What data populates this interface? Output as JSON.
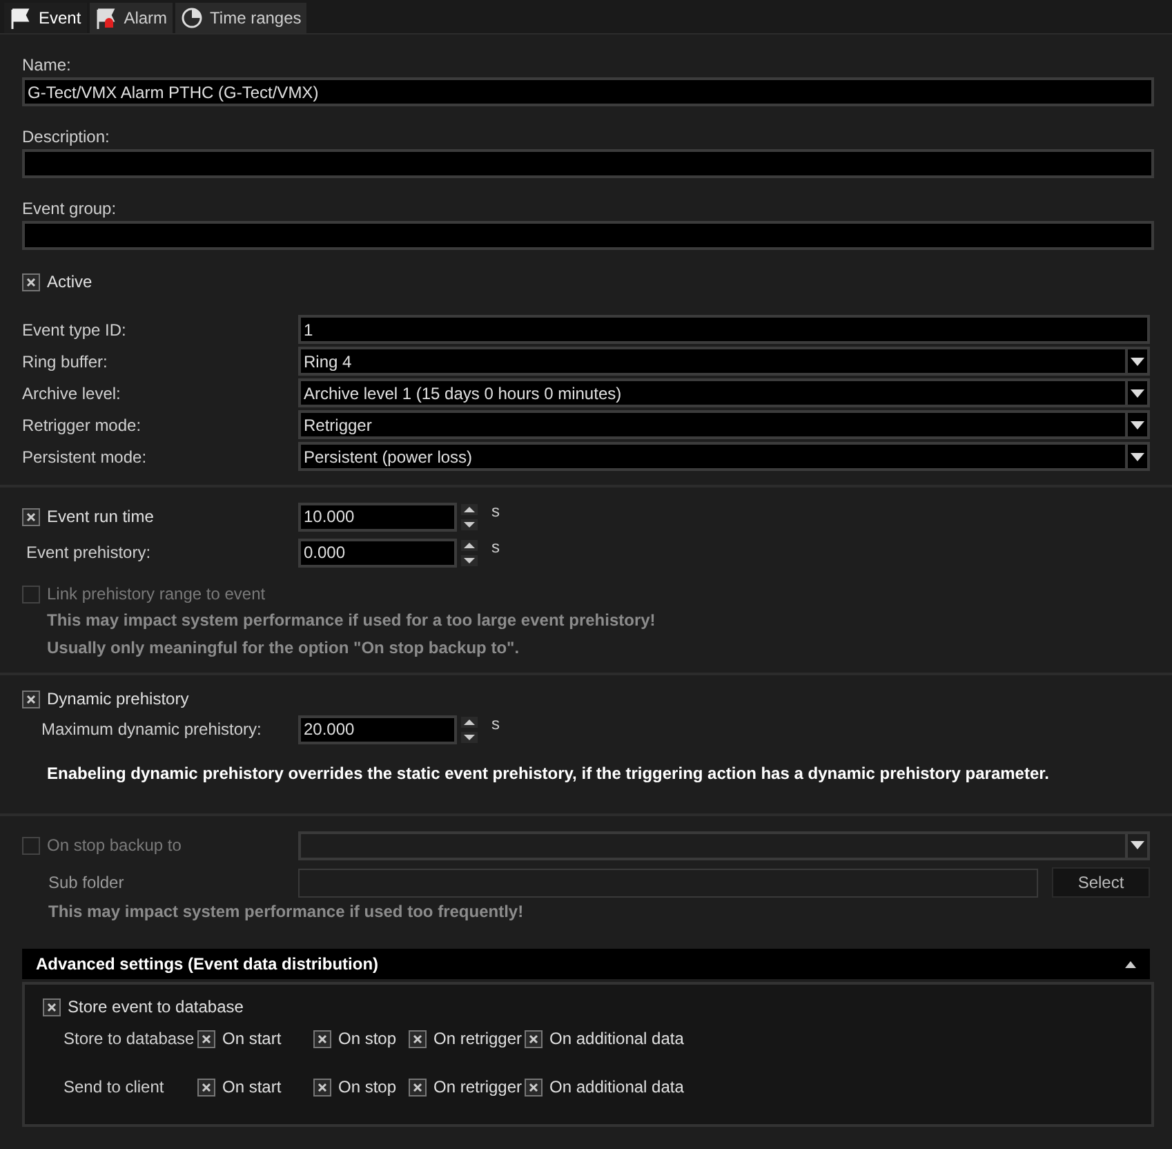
{
  "tabs": [
    {
      "label": "Event",
      "kind": "flag",
      "selected": true
    },
    {
      "label": "Alarm",
      "kind": "alarm",
      "selected": false
    },
    {
      "label": "Time ranges",
      "kind": "clock",
      "selected": false
    }
  ],
  "text_fields": [
    {
      "label": "Name:",
      "value": "G-Tect/VMX Alarm PTHC (G-Tect/VMX)"
    },
    {
      "label": "Description:"
    },
    {
      "label": "Event group:"
    }
  ],
  "active": {
    "label": "Active",
    "checked": true
  },
  "params": [
    {
      "label": "Event type ID:",
      "kind": "input",
      "value": "1"
    },
    {
      "label": "Ring buffer:",
      "kind": "select",
      "value": "Ring 4"
    },
    {
      "label": "Archive level:",
      "kind": "select",
      "value": "Archive level 1 (15 days 0 hours 0 minutes)"
    },
    {
      "label": "Retrigger mode:",
      "kind": "select",
      "value": "Retrigger"
    },
    {
      "label": "Persistent mode:",
      "kind": "select",
      "value": "Persistent (power loss)"
    }
  ],
  "run_time": {
    "label": "Event run time",
    "checked": true,
    "value": "10.000",
    "unit": "s"
  },
  "prehistory": {
    "label": "Event prehistory:",
    "value": "0.000",
    "unit": "s"
  },
  "link_prehistory": {
    "label": "Link prehistory range to event",
    "checked": false,
    "disabled": true
  },
  "link_notes": [
    "This may impact system performance if used for a too large event prehistory!",
    "Usually only meaningful for the option \"On stop backup to\"."
  ],
  "dynamic_prehistory": {
    "label": "Dynamic prehistory",
    "checked": true
  },
  "max_dynamic": {
    "label": "Maximum dynamic prehistory:",
    "value": "20.000",
    "unit": "s"
  },
  "dynamic_note": "Enabeling dynamic prehistory overrides the static event prehistory, if the triggering action has a dynamic prehistory parameter.",
  "backup": {
    "label": "On stop backup to",
    "checked": false,
    "disabled": true
  },
  "sub_folder": {
    "label": "Sub folder",
    "button": "Select"
  },
  "backup_note": "This may impact system performance if used too frequently!",
  "advanced": {
    "title": "Advanced settings (Event data distribution)",
    "expanded": true,
    "store_event": {
      "label": "Store event to database",
      "checked": true
    },
    "rows": [
      {
        "label": "Store to database",
        "options": [
          {
            "label": "On start",
            "checked": true
          },
          {
            "label": "On stop",
            "checked": true
          },
          {
            "label": "On retrigger",
            "checked": true
          },
          {
            "label": "On additional data",
            "checked": true
          }
        ]
      },
      {
        "label": "Send to client",
        "options": [
          {
            "label": "On start",
            "checked": true
          },
          {
            "label": "On stop",
            "checked": true
          },
          {
            "label": "On retrigger",
            "checked": true
          },
          {
            "label": "On additional data",
            "checked": true
          }
        ]
      }
    ]
  }
}
